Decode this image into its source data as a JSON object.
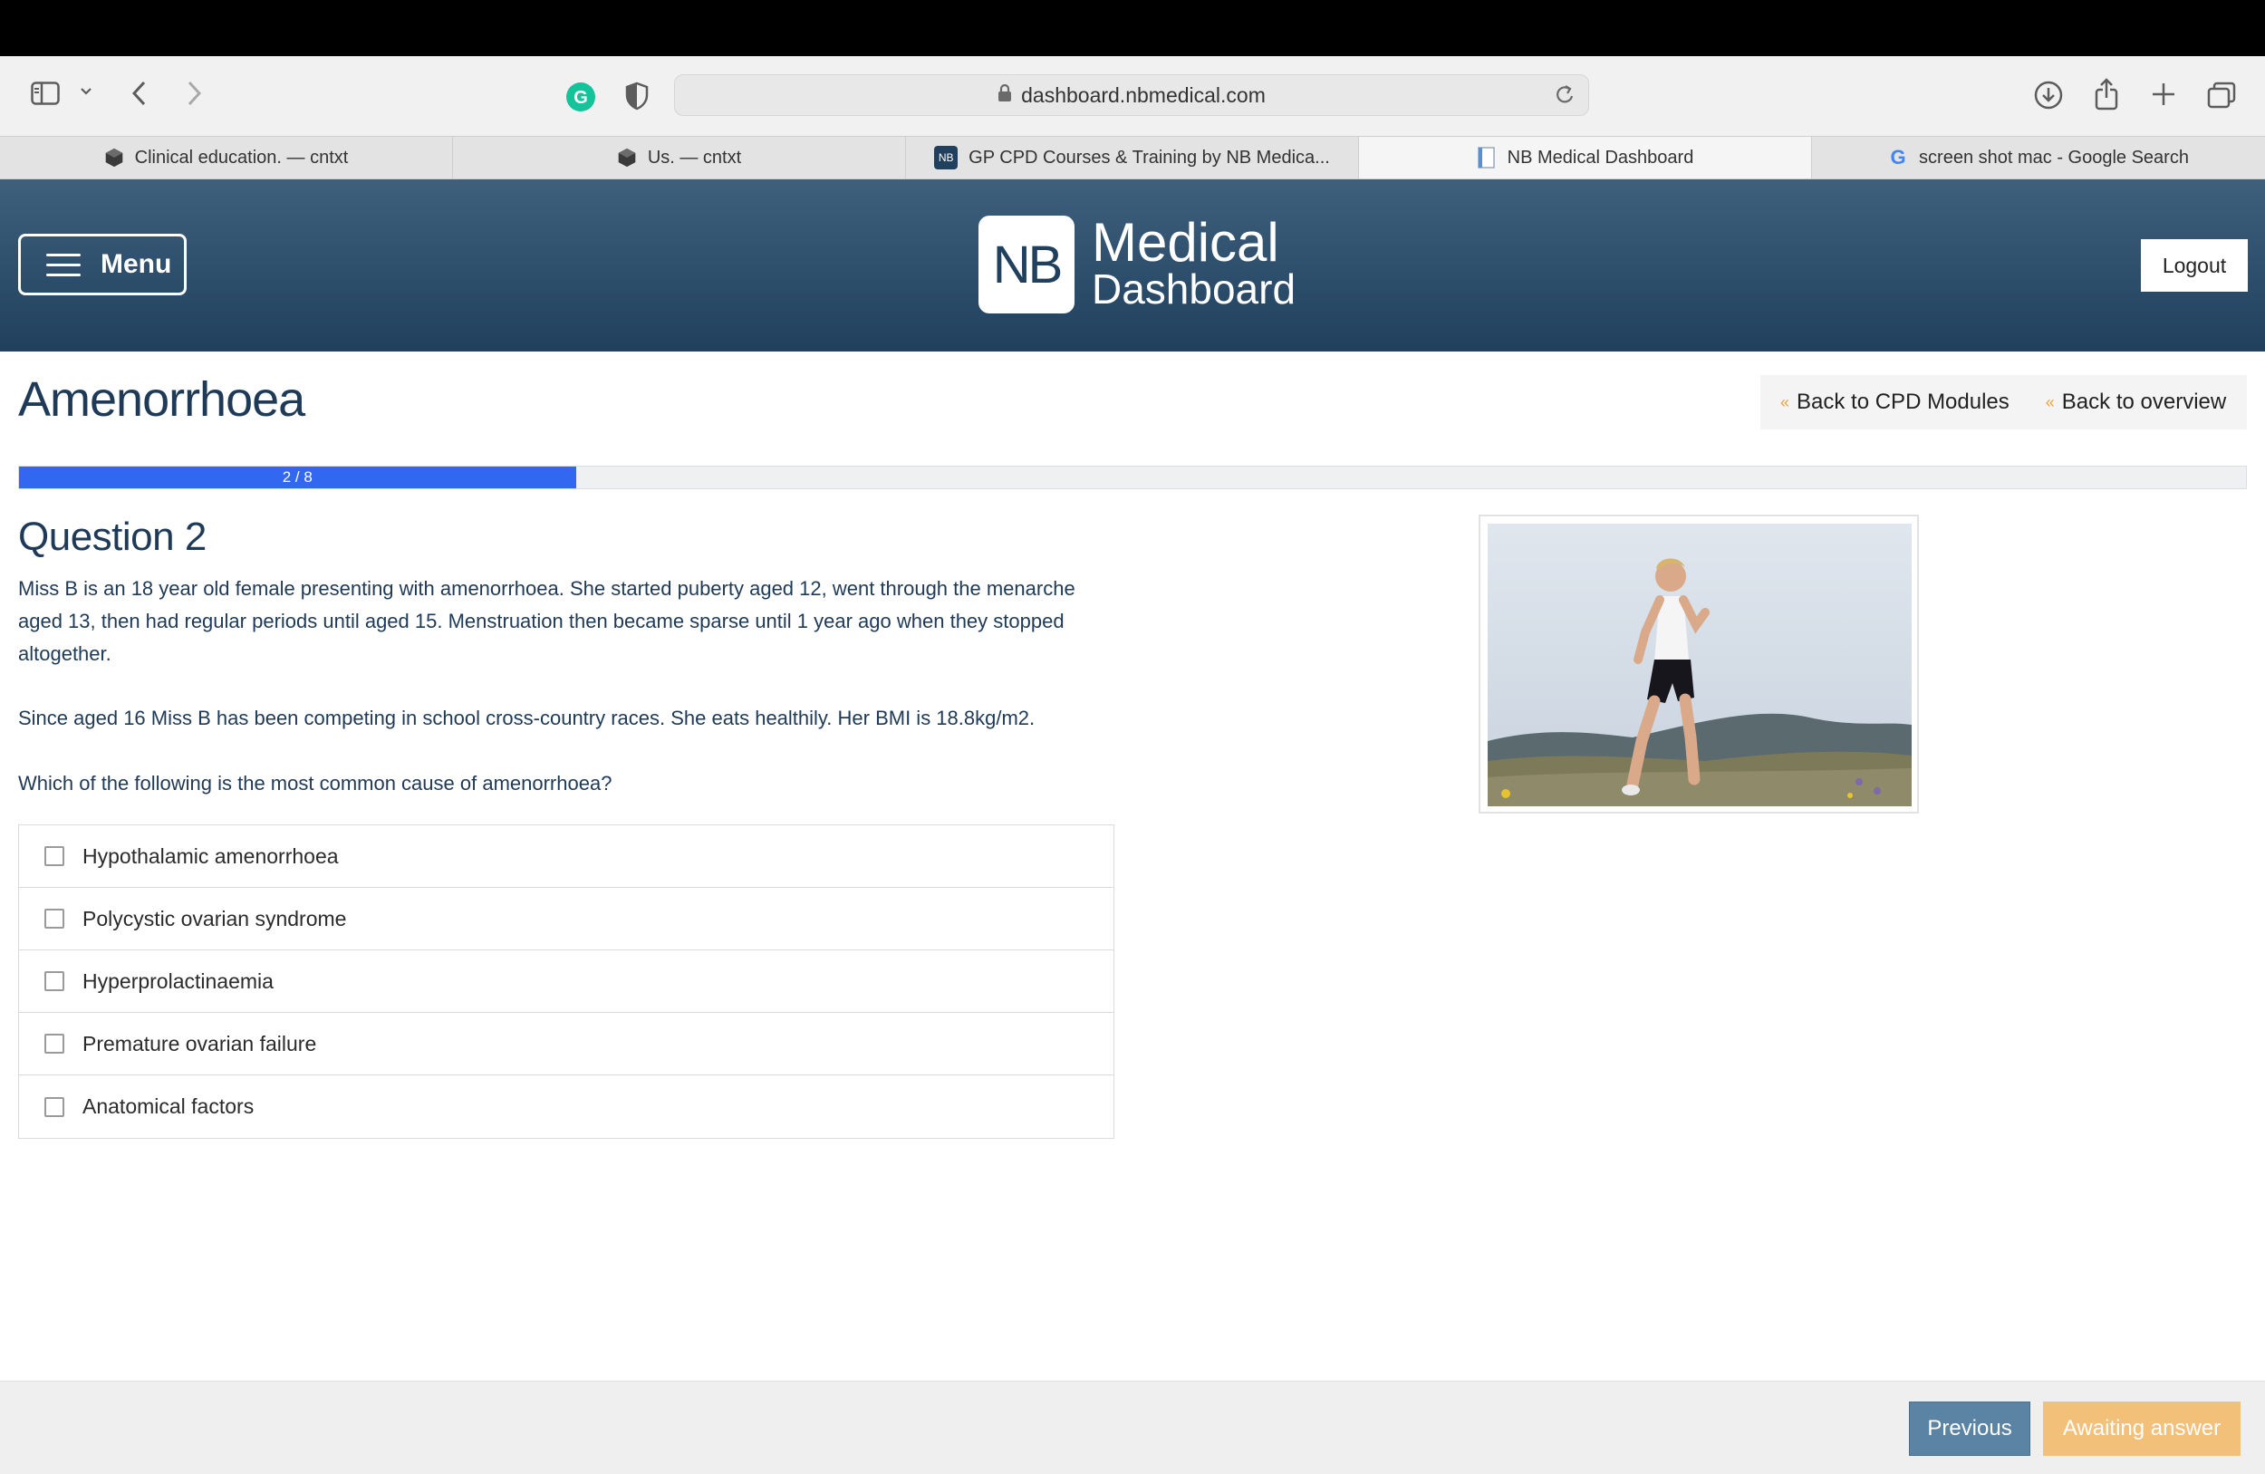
{
  "browser": {
    "url": "dashboard.nbmedical.com",
    "icons": [
      "sidebar-icon",
      "chevron-down-icon",
      "back-icon",
      "forward-icon",
      "grammarly-icon",
      "shield-icon",
      "lock-icon",
      "reload-icon",
      "download-icon",
      "share-icon",
      "new-tab-icon",
      "tab-overview-icon"
    ],
    "tabs": [
      {
        "label": "Clinical education. — cntxt",
        "icon": "cube-icon"
      },
      {
        "label": "Us. — cntxt",
        "icon": "cube-icon"
      },
      {
        "label": "GP CPD Courses & Training by NB Medica...",
        "icon": "nb-favicon",
        "favicon_text": "NB"
      },
      {
        "label": "NB Medical Dashboard",
        "icon": "document-icon",
        "active": true
      },
      {
        "label": "screen shot mac - Google Search",
        "icon": "google-icon",
        "favicon_text": "G"
      }
    ]
  },
  "header": {
    "menu_label": "Menu",
    "logo_mark": "NB",
    "logo_line1": "Medical",
    "logo_line2": "Dashboard",
    "logout_label": "Logout",
    "colors": {
      "header_top": "#3e607d",
      "header_bottom": "#20405e"
    }
  },
  "page": {
    "title": "Amenorrhoea",
    "nav": {
      "back_to_modules": "Back to CPD Modules",
      "back_to_overview": "Back to overview",
      "chevron": "«"
    },
    "progress": {
      "label": "2 / 8",
      "current": 2,
      "total": 8,
      "fraction": 0.25,
      "color": "#3268f0"
    }
  },
  "question": {
    "title": "Question 2",
    "paragraphs": [
      "Miss B is an 18 year old female presenting with amenorrhoea. She started puberty aged 12, went through the menarche aged 13, then had regular periods until aged 15. Menstruation then became sparse until 1 year ago when they stopped altogether.",
      "Since aged 16 Miss B has been competing in school cross-country races. She eats healthily. Her BMI is 18.8kg/m2.",
      "Which of the following is the most common cause of amenorrhoea?"
    ],
    "options": [
      {
        "label": "Hypothalamic amenorrhoea",
        "checked": false
      },
      {
        "label": "Polycystic ovarian syndrome",
        "checked": false
      },
      {
        "label": "Hyperprolactinaemia",
        "checked": false
      },
      {
        "label": "Premature ovarian failure",
        "checked": false
      },
      {
        "label": "Anatomical factors",
        "checked": false
      }
    ]
  },
  "footer": {
    "previous_label": "Previous",
    "awaiting_label": "Awaiting answer",
    "colors": {
      "previous": "#5b83a3",
      "awaiting": "#f3c07a"
    }
  }
}
